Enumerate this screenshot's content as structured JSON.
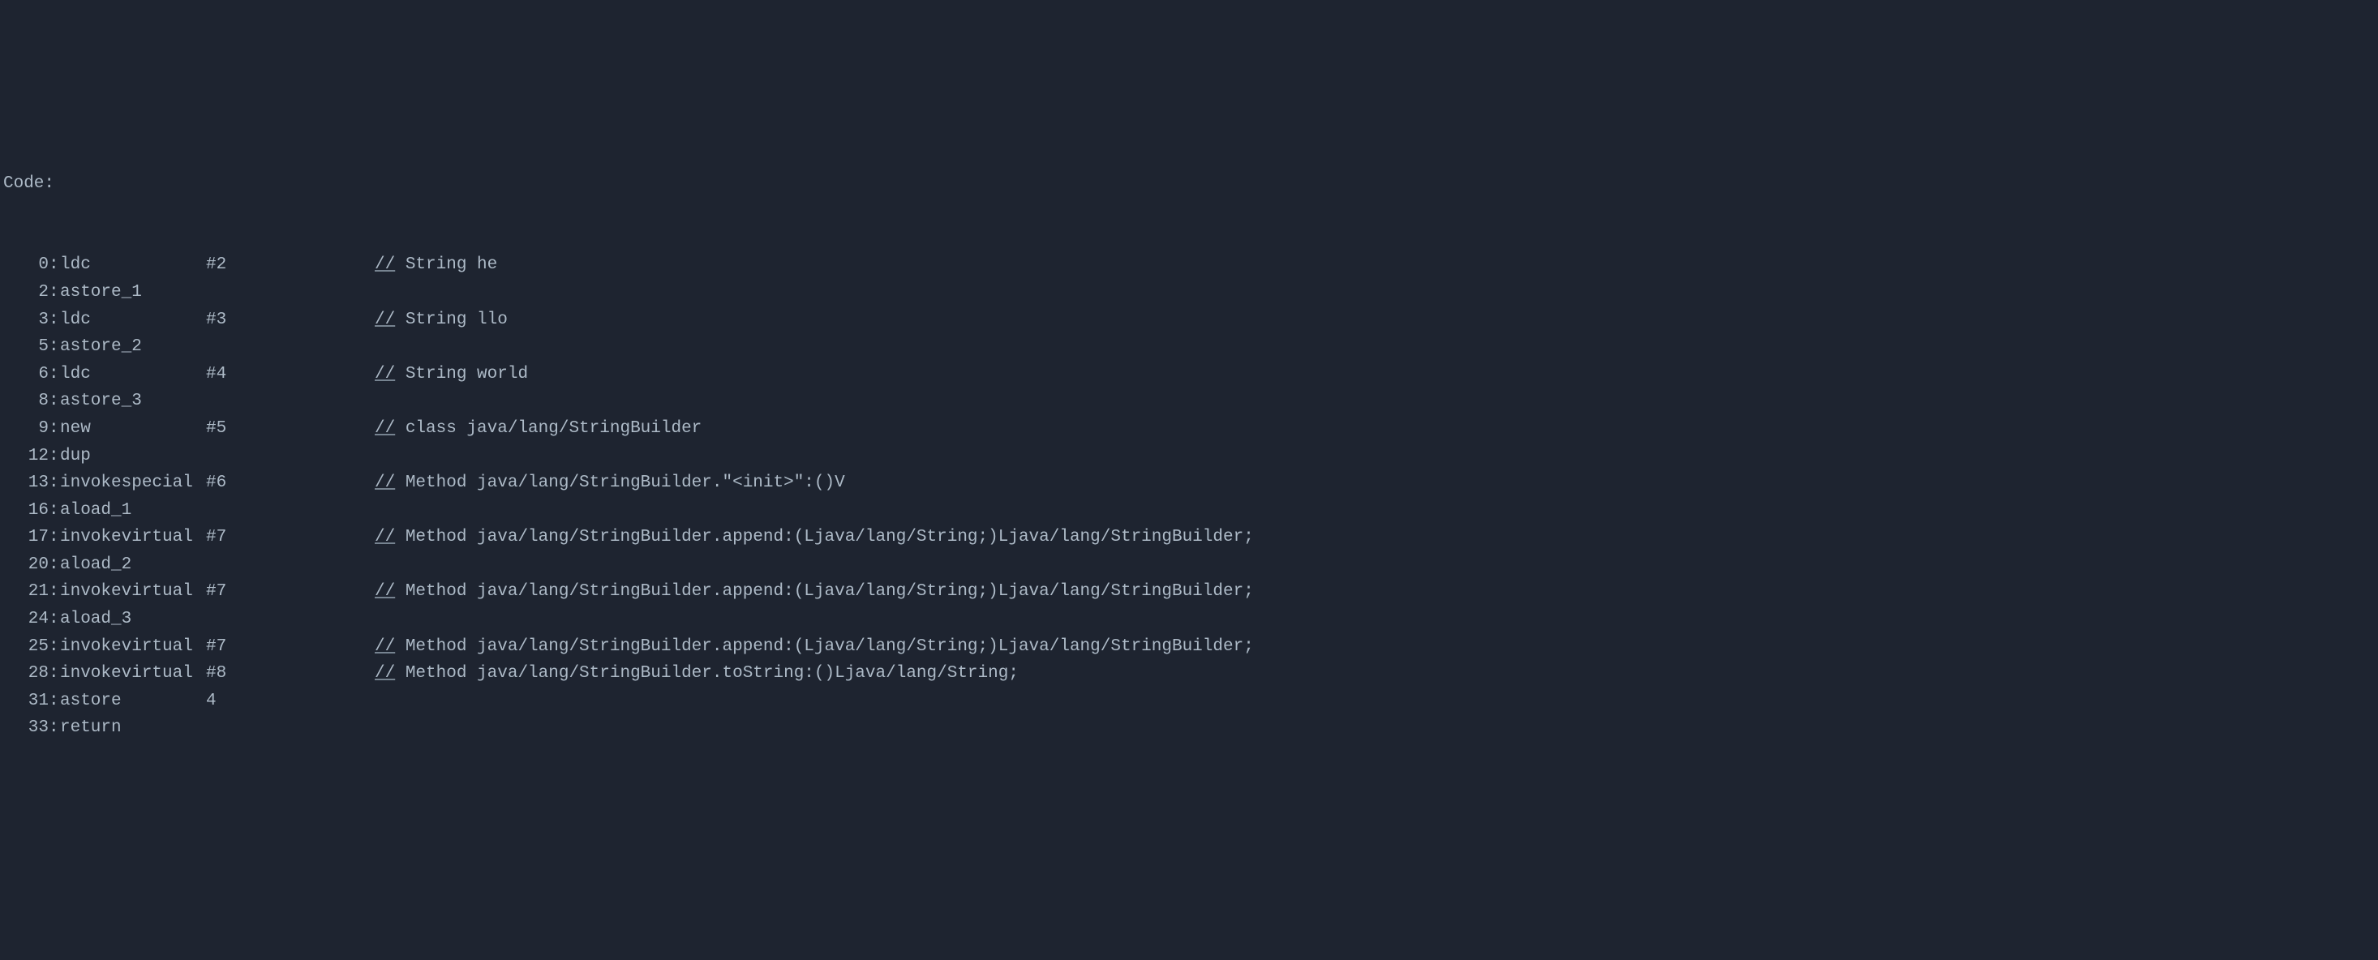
{
  "header": "Code:",
  "lines": [
    {
      "offset": "0",
      "instruction": "ldc",
      "operand": "#2",
      "comment": "String he"
    },
    {
      "offset": "2",
      "instruction": "astore_1",
      "operand": "",
      "comment": ""
    },
    {
      "offset": "3",
      "instruction": "ldc",
      "operand": "#3",
      "comment": "String llo"
    },
    {
      "offset": "5",
      "instruction": "astore_2",
      "operand": "",
      "comment": ""
    },
    {
      "offset": "6",
      "instruction": "ldc",
      "operand": "#4",
      "comment": "String world"
    },
    {
      "offset": "8",
      "instruction": "astore_3",
      "operand": "",
      "comment": ""
    },
    {
      "offset": "9",
      "instruction": "new",
      "operand": "#5",
      "comment": "class java/lang/StringBuilder"
    },
    {
      "offset": "12",
      "instruction": "dup",
      "operand": "",
      "comment": ""
    },
    {
      "offset": "13",
      "instruction": "invokespecial",
      "operand": "#6",
      "comment": "Method java/lang/StringBuilder.\"<init>\":()V"
    },
    {
      "offset": "16",
      "instruction": "aload_1",
      "operand": "",
      "comment": ""
    },
    {
      "offset": "17",
      "instruction": "invokevirtual",
      "operand": "#7",
      "comment": "Method java/lang/StringBuilder.append:(Ljava/lang/String;)Ljava/lang/StringBuilder;"
    },
    {
      "offset": "20",
      "instruction": "aload_2",
      "operand": "",
      "comment": ""
    },
    {
      "offset": "21",
      "instruction": "invokevirtual",
      "operand": "#7",
      "comment": "Method java/lang/StringBuilder.append:(Ljava/lang/String;)Ljava/lang/StringBuilder;"
    },
    {
      "offset": "24",
      "instruction": "aload_3",
      "operand": "",
      "comment": ""
    },
    {
      "offset": "25",
      "instruction": "invokevirtual",
      "operand": "#7",
      "comment": "Method java/lang/StringBuilder.append:(Ljava/lang/String;)Ljava/lang/StringBuilder;"
    },
    {
      "offset": "28",
      "instruction": "invokevirtual",
      "operand": "#8",
      "comment": "Method java/lang/StringBuilder.toString:()Ljava/lang/String;"
    },
    {
      "offset": "31",
      "instruction": "astore",
      "operand": "4",
      "comment": ""
    },
    {
      "offset": "33",
      "instruction": "return",
      "operand": "",
      "comment": ""
    }
  ],
  "comment_prefix": "//"
}
